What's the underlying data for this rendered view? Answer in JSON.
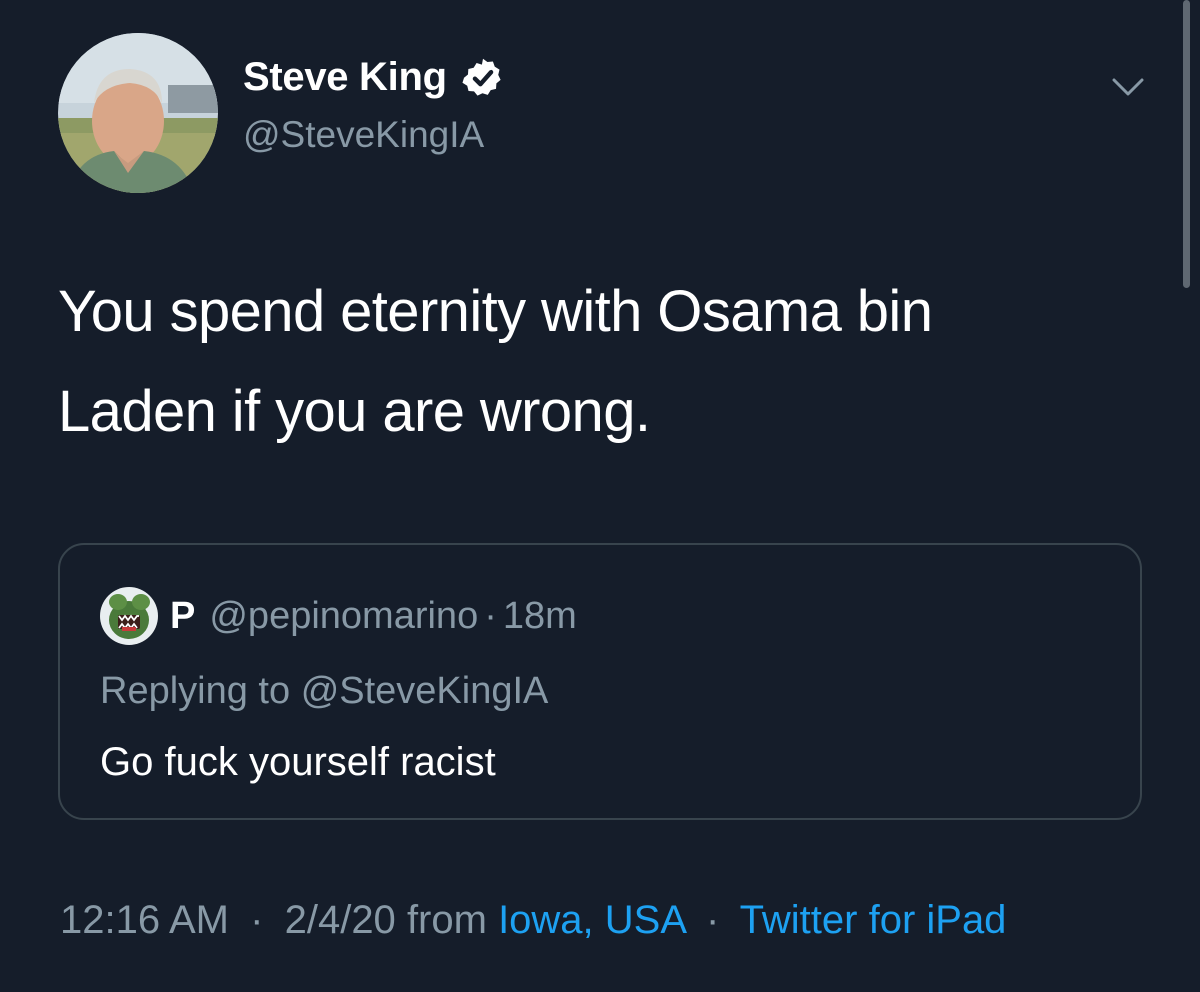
{
  "tweet": {
    "author": {
      "name": "Steve King",
      "handle": "@SteveKingIA",
      "verified": true
    },
    "text_line1": "You spend eternity with Osama bin",
    "text_line2": "Laden if you are wrong.",
    "quoted_tweet": {
      "name": "P",
      "handle": "@pepinomarino",
      "separator": "·",
      "time": "18m",
      "replying_prefix": "Replying to",
      "replying_to": "@SteveKingIA",
      "text": "Go fuck yourself racist"
    },
    "meta": {
      "time": "12:16 AM",
      "separator": "·",
      "date": "2/4/20",
      "from": "from",
      "location": "Iowa, USA",
      "client": "Twitter for iPad"
    }
  },
  "icons": {
    "verified": "verified-badge-icon",
    "menu": "chevron-down-icon"
  },
  "colors": {
    "background": "#151d2a",
    "text_primary": "#ffffff",
    "text_secondary": "#8899a6",
    "link": "#1da1f2",
    "border": "#38444d"
  }
}
